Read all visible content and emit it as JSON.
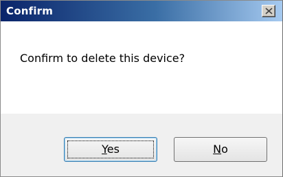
{
  "window": {
    "title": "Confirm"
  },
  "dialog": {
    "message": "Confirm to delete this device?"
  },
  "buttons": {
    "yes": {
      "mnemonic": "Y",
      "rest": "es"
    },
    "no": {
      "mnemonic": "N",
      "rest": "o"
    }
  },
  "colors": {
    "titlebar_start": "#0a246a",
    "titlebar_end": "#a6caf0",
    "footer_bg": "#f0f0f0",
    "default_button_border": "#3c7fb1"
  },
  "icons": {
    "close": "close-icon"
  }
}
